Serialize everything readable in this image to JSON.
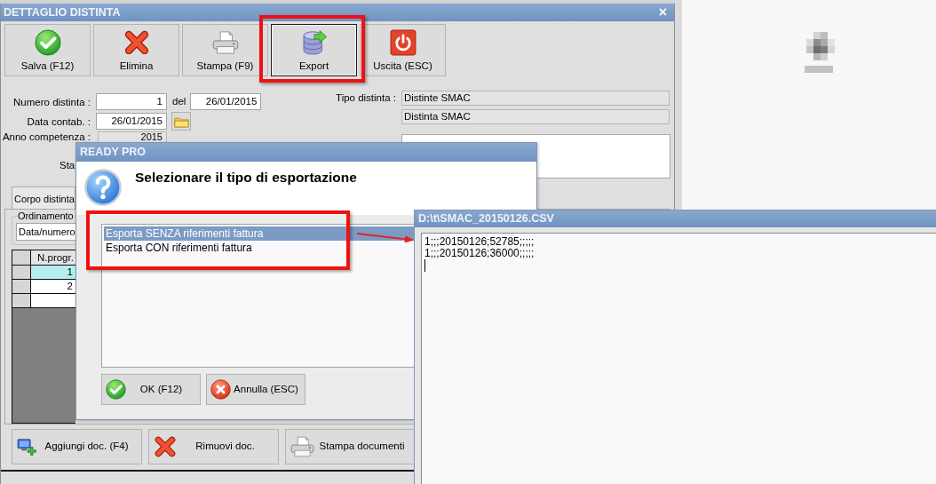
{
  "main_window": {
    "title": "DETTAGLIO DISTINTA",
    "close": "×"
  },
  "toolbar": [
    {
      "kind": "save",
      "label": "Salva (F12)",
      "focused": false
    },
    {
      "kind": "delete",
      "label": "Elimina",
      "focused": false
    },
    {
      "kind": "print",
      "label": "Stampa (F9)",
      "focused": false
    },
    {
      "kind": "export",
      "label": "Export",
      "focused": true
    },
    {
      "kind": "exit",
      "label": "Uscita (ESC)",
      "focused": false
    }
  ],
  "form": {
    "numero_distinta": {
      "label": "Numero distinta :",
      "value": "1",
      "disabled": false
    },
    "del": {
      "label": "del",
      "value": "26/01/2015",
      "disabled": false
    },
    "data_contab": {
      "label": "Data contab. :",
      "value": "26/01/2015",
      "disabled": false
    },
    "anno_competenza": {
      "label": "Anno competenza :",
      "value": "2015",
      "disabled": true
    },
    "row_4_label": "Sta",
    "tipo_distinta": {
      "label": "Tipo distinta :",
      "value": "Distinte SMAC",
      "description": "Distinta SMAC",
      "disabled": true
    }
  },
  "body_panel": {
    "tab": "Corpo distinta",
    "ordinamento": {
      "label": "Ordinamento",
      "value": "Data/numero"
    },
    "grid": {
      "columns": [
        "N.progr."
      ],
      "rows": [
        {
          "cells": [
            "1"
          ],
          "selected": true
        },
        {
          "cells": [
            "2"
          ],
          "selected": false
        }
      ]
    }
  },
  "bottom_buttons": [
    {
      "kind": "add",
      "label": "Aggiungi doc. (F4)"
    },
    {
      "kind": "remove",
      "label": "Rimuovi doc."
    },
    {
      "kind": "print",
      "label": "Stampa documenti"
    }
  ],
  "dialog": {
    "title": "READY PRO",
    "message": "Selezionare il tipo di esportazione",
    "options": [
      {
        "label": "Esporta SENZA riferimenti fattura",
        "selected": true
      },
      {
        "label": "Esporta CON riferimenti fattura",
        "selected": false
      }
    ],
    "buttons": [
      {
        "kind": "ok",
        "label": "OK (F12)"
      },
      {
        "kind": "cancel",
        "label": "Annulla (ESC)"
      }
    ]
  },
  "file_window": {
    "title": "D:\\t\\SMAC_20150126.CSV",
    "lines": [
      "1;;;20150126;52785;;;;;",
      "1;;;20150126;36000;;;;;"
    ]
  }
}
